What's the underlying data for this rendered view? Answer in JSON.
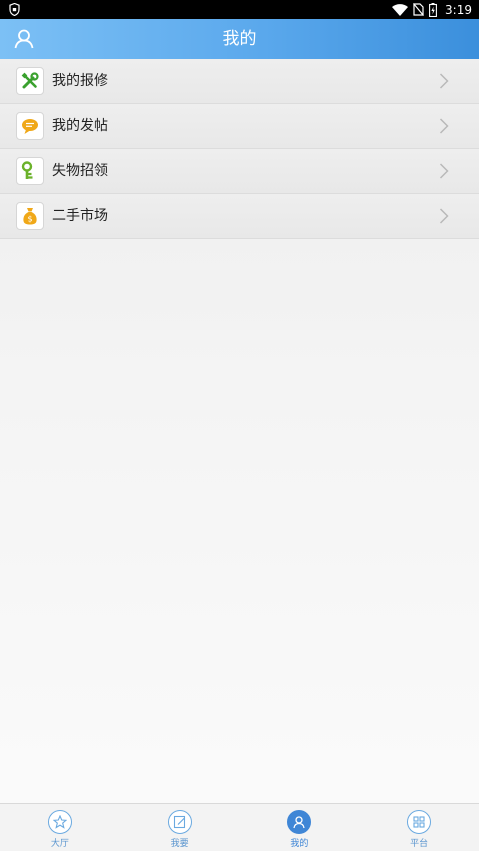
{
  "status_bar": {
    "time": "3:19",
    "icons": [
      "shield-icon",
      "wifi-icon",
      "no-sim-icon",
      "battery-charging-icon"
    ]
  },
  "header": {
    "title": "我的",
    "left_icon": "user-icon"
  },
  "menu": {
    "items": [
      {
        "label": "我的报修",
        "icon": "tools-icon",
        "icon_color": "#3aa12e"
      },
      {
        "label": "我的发帖",
        "icon": "chat-bubble-icon",
        "icon_color": "#f0a818"
      },
      {
        "label": "失物招领",
        "icon": "key-icon",
        "icon_color": "#6bb22a"
      },
      {
        "label": "二手市场",
        "icon": "money-bag-icon",
        "icon_color": "#f0a818"
      }
    ]
  },
  "bottom_nav": {
    "items": [
      {
        "label": "大厅",
        "icon": "star-icon",
        "active": false
      },
      {
        "label": "我要",
        "icon": "edit-icon",
        "active": false
      },
      {
        "label": "我的",
        "icon": "person-icon",
        "active": true
      },
      {
        "label": "平台",
        "icon": "grid-icon",
        "active": false
      }
    ]
  },
  "colors": {
    "header_start": "#7cc0f5",
    "header_end": "#3b8fdc",
    "nav_active": "#3f86d6",
    "nav_inactive": "#5a95cf"
  }
}
